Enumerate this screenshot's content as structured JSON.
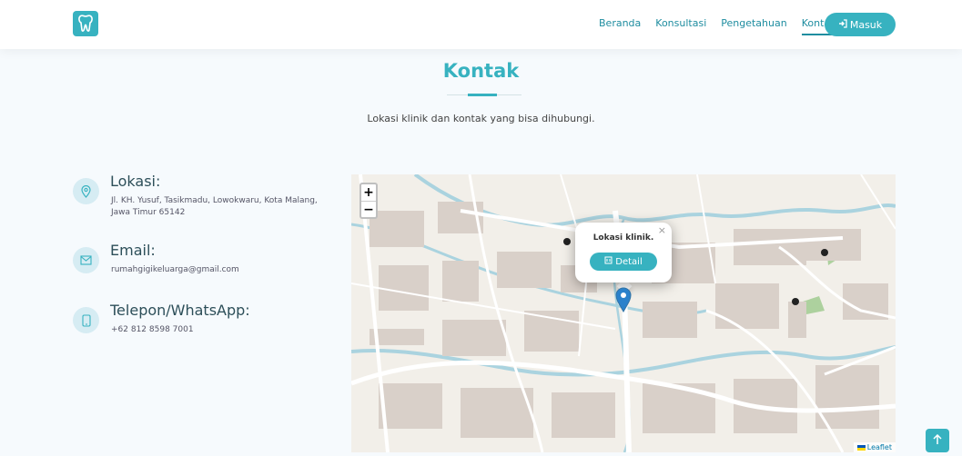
{
  "nav": {
    "links": [
      "Beranda",
      "Konsultasi",
      "Pengetahuan",
      "Kontak"
    ],
    "active": "Kontak",
    "login_label": "Masuk"
  },
  "section": {
    "title": "Kontak",
    "subtitle": "Lokasi klinik dan kontak yang bisa dihubungi."
  },
  "contact": {
    "location": {
      "heading": "Lokasi:",
      "text": "Jl. KH. Yusuf, Tasikmadu, Lowokwaru, Kota Malang, Jawa Timur 65142"
    },
    "email": {
      "heading": "Email:",
      "text": "rumahgigikeluarga@gmail.com"
    },
    "phone": {
      "heading": "Telepon/WhatsApp:",
      "text": "+62 812 8598 7001"
    }
  },
  "map": {
    "zoom_in": "+",
    "zoom_out": "−",
    "popup_text": "Lokasi klinik.",
    "popup_button": "Detail",
    "popup_close": "×",
    "attribution": "Leaflet"
  },
  "colors": {
    "accent": "#37b2c0",
    "nav_text": "#1f8da0",
    "marker": "#2a81cb"
  },
  "icons": [
    "tooth-logo-icon",
    "sign-in-icon",
    "location-pin-icon",
    "envelope-icon",
    "phone-icon",
    "building-icon",
    "arrow-up-icon",
    "map-marker-icon"
  ]
}
